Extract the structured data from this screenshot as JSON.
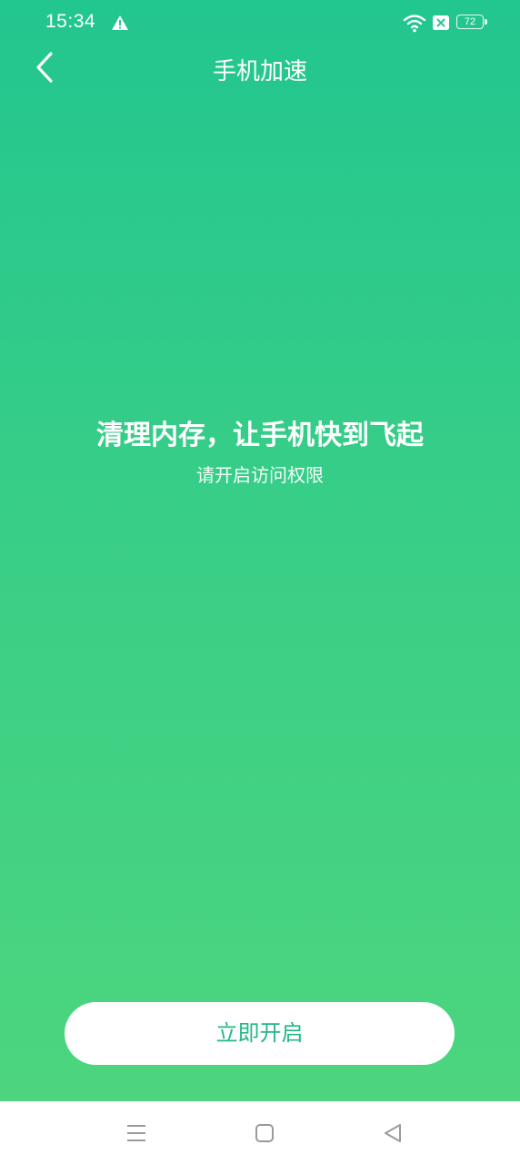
{
  "status_bar": {
    "time": "15:34",
    "battery_level": "72",
    "icons": [
      "warning-icon",
      "wifi-icon",
      "sim-off-icon",
      "battery-icon"
    ]
  },
  "header": {
    "title": "手机加速",
    "back_icon": "chevron-left-icon"
  },
  "main": {
    "headline": "清理内存，让手机快到飞起",
    "subheadline": "请开启访问权限"
  },
  "action": {
    "button_label": "立即开启"
  },
  "nav_bar": {
    "icons": [
      "menu-icon",
      "home-icon",
      "back-triangle-icon"
    ]
  },
  "colors": {
    "gradient_top": "#22c68f",
    "gradient_bottom": "#4fd67d",
    "button_text": "#23b886",
    "white": "#ffffff"
  }
}
